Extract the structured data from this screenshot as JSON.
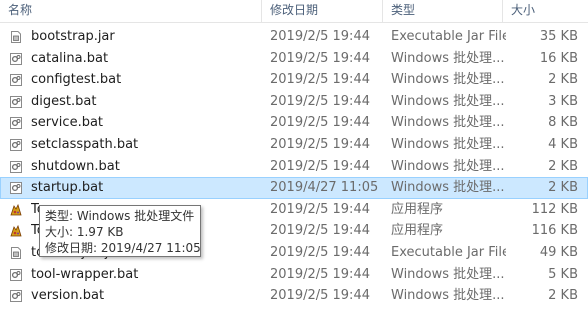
{
  "columns": {
    "name": "名称",
    "date": "修改日期",
    "type": "类型",
    "size": "大小"
  },
  "files": [
    {
      "name": "bootstrap.jar",
      "date": "2019/2/5 19:44",
      "type": "Executable Jar File",
      "size": "35 KB",
      "icon": "jar-file-icon"
    },
    {
      "name": "catalina.bat",
      "date": "2019/2/5 19:44",
      "type": "Windows 批处理...",
      "size": "16 KB",
      "icon": "batch-file-icon"
    },
    {
      "name": "configtest.bat",
      "date": "2019/2/5 19:44",
      "type": "Windows 批处理...",
      "size": "2 KB",
      "icon": "batch-file-icon"
    },
    {
      "name": "digest.bat",
      "date": "2019/2/5 19:44",
      "type": "Windows 批处理...",
      "size": "3 KB",
      "icon": "batch-file-icon"
    },
    {
      "name": "service.bat",
      "date": "2019/2/5 19:44",
      "type": "Windows 批处理...",
      "size": "8 KB",
      "icon": "batch-file-icon"
    },
    {
      "name": "setclasspath.bat",
      "date": "2019/2/5 19:44",
      "type": "Windows 批处理...",
      "size": "4 KB",
      "icon": "batch-file-icon"
    },
    {
      "name": "shutdown.bat",
      "date": "2019/2/5 19:44",
      "type": "Windows 批处理...",
      "size": "2 KB",
      "icon": "batch-file-icon"
    },
    {
      "name": "startup.bat",
      "date": "2019/4/27 11:05",
      "type": "Windows 批处理...",
      "size": "2 KB",
      "icon": "batch-file-icon",
      "selected": true
    },
    {
      "name": "To",
      "date": "2019/2/5 19:44",
      "type": "应用程序",
      "size": "112 KB",
      "icon": "tomcat-exe-icon"
    },
    {
      "name": "To",
      "date": "2019/2/5 19:44",
      "type": "应用程序",
      "size": "116 KB",
      "icon": "tomcat-exe-icon"
    },
    {
      "name": "tomcat-juli.jar",
      "date": "2019/2/5 19:44",
      "type": "Executable Jar File",
      "size": "49 KB",
      "icon": "jar-file-icon"
    },
    {
      "name": "tool-wrapper.bat",
      "date": "2019/2/5 19:44",
      "type": "Windows 批处理...",
      "size": "5 KB",
      "icon": "batch-file-icon"
    },
    {
      "name": "version.bat",
      "date": "2019/2/5 19:44",
      "type": "Windows 批处理...",
      "size": "2 KB",
      "icon": "batch-file-icon"
    }
  ],
  "tooltip": {
    "type_line": "类型: Windows 批处理文件",
    "size_line": "大小: 1.97 KB",
    "date_line": "修改日期: 2019/4/27 11:05"
  },
  "colors": {
    "selection": "#cce8ff",
    "selection_border": "#99d1ff",
    "header_text": "#4c607a"
  }
}
